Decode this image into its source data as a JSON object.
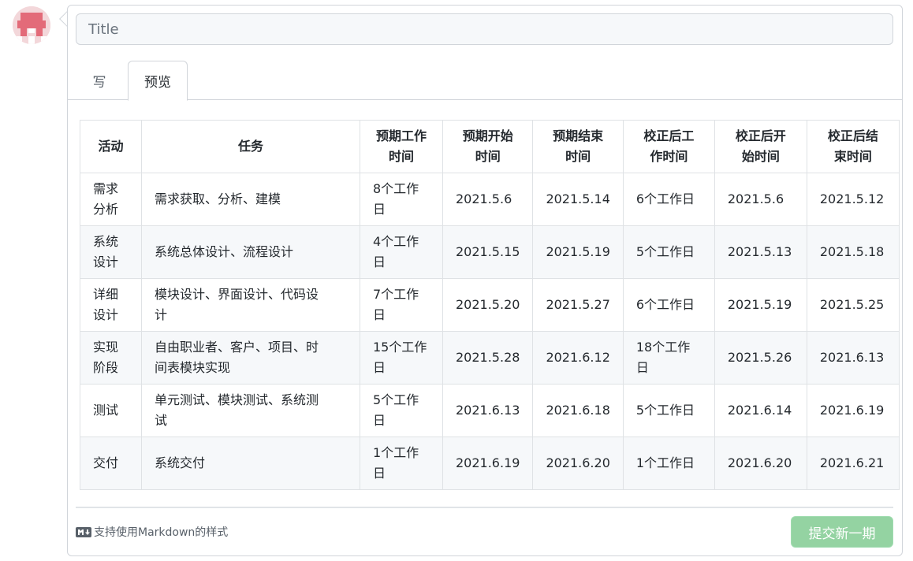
{
  "title_field": {
    "placeholder": "Title",
    "value": ""
  },
  "tabs": [
    {
      "label": "写",
      "active": false
    },
    {
      "label": "预览",
      "active": true
    }
  ],
  "table": {
    "headers": [
      [
        "活动"
      ],
      [
        "任务"
      ],
      [
        "预期工作",
        "时间"
      ],
      [
        "预期开始",
        "时间"
      ],
      [
        "预期结束",
        "时间"
      ],
      [
        "校正后工",
        "作时间"
      ],
      [
        "校正后开",
        "始时间"
      ],
      [
        "校正后结",
        "束时间"
      ]
    ],
    "rows": [
      [
        [
          "需求",
          "分析"
        ],
        [
          "需求获取、分析、建模"
        ],
        [
          "8个工作",
          "日"
        ],
        [
          "2021.5.6"
        ],
        [
          "2021.5.14"
        ],
        [
          "6个工作日"
        ],
        [
          "2021.5.6"
        ],
        [
          "2021.5.12"
        ]
      ],
      [
        [
          "系统",
          "设计"
        ],
        [
          "系统总体设计、流程设计"
        ],
        [
          "4个工作",
          "日"
        ],
        [
          "2021.5.15"
        ],
        [
          "2021.5.19"
        ],
        [
          "5个工作日"
        ],
        [
          "2021.5.13"
        ],
        [
          "2021.5.18"
        ]
      ],
      [
        [
          "详细",
          "设计"
        ],
        [
          "模块设计、界面设计、代码设",
          "计"
        ],
        [
          "7个工作",
          "日"
        ],
        [
          "2021.5.20"
        ],
        [
          "2021.5.27"
        ],
        [
          "6个工作日"
        ],
        [
          "2021.5.19"
        ],
        [
          "2021.5.25"
        ]
      ],
      [
        [
          "实现",
          "阶段"
        ],
        [
          "自由职业者、客户、项目、时",
          "间表模块实现"
        ],
        [
          "15个工作",
          "日"
        ],
        [
          "2021.5.28"
        ],
        [
          "2021.6.12"
        ],
        [
          "18个工作",
          "日"
        ],
        [
          "2021.5.26"
        ],
        [
          "2021.6.13"
        ]
      ],
      [
        [
          "测试"
        ],
        [
          "单元测试、模块测试、系统测",
          "试"
        ],
        [
          "5个工作",
          "日"
        ],
        [
          "2021.6.13"
        ],
        [
          "2021.6.18"
        ],
        [
          "5个工作日"
        ],
        [
          "2021.6.14"
        ],
        [
          "2021.6.19"
        ]
      ],
      [
        [
          "交付"
        ],
        [
          "系统交付"
        ],
        [
          "1个工作",
          "日"
        ],
        [
          "2021.6.19"
        ],
        [
          "2021.6.20"
        ],
        [
          "1个工作日"
        ],
        [
          "2021.6.20"
        ],
        [
          "2021.6.21"
        ]
      ]
    ]
  },
  "footer": {
    "markdown_note": "支持使用Markdown的样式",
    "submit_label": "提交新一期"
  },
  "colors": {
    "submit_bg": "#94d3a2",
    "avatar_accent": "#e36b79",
    "stripe_row": "#f6f8fa"
  },
  "icons": {
    "avatar": "identicon-avatar",
    "markdown": "markdown-icon"
  }
}
